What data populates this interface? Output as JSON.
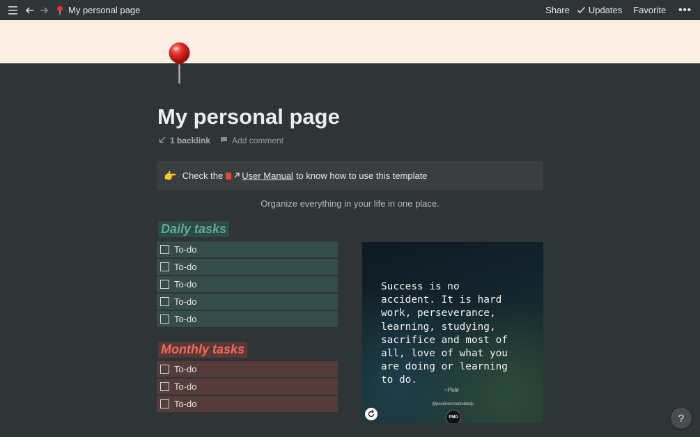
{
  "topbar": {
    "page_title": "My personal page",
    "share_label": "Share",
    "updates_label": "Updates",
    "favorite_label": "Favorite",
    "more_label": "•••"
  },
  "page": {
    "title": "My personal page",
    "backlink_count": "1 backlink",
    "add_comment": "Add comment"
  },
  "callout": {
    "emoji": "👉",
    "prefix": "Check the",
    "link_text": "User Manual",
    "suffix": "to know how to use this template"
  },
  "subtitle": "Organize everything in your life in one place.",
  "daily": {
    "heading": "Daily tasks",
    "items": [
      "To-do",
      "To-do",
      "To-do",
      "To-do",
      "To-do"
    ]
  },
  "monthly": {
    "heading": "Monthly tasks",
    "items": [
      "To-do",
      "To-do",
      "To-do"
    ]
  },
  "quote": {
    "text": "Success is no\naccident. It is hard\nwork, perseverance,\nlearning, studying,\nsacrifice and most of\nall, love of what you\nare doing or learning\nto do.",
    "author": "~Pelé",
    "handle": "@positivemindsetdaily",
    "logo_text": "PMD"
  },
  "help_label": "?",
  "colors": {
    "background": "#2f3437",
    "cover": "#fcefe3",
    "daily_bg": "#354c4b",
    "daily_heading": "#5fa89b",
    "monthly_bg": "#553b39",
    "monthly_heading": "#ee6b5f"
  }
}
